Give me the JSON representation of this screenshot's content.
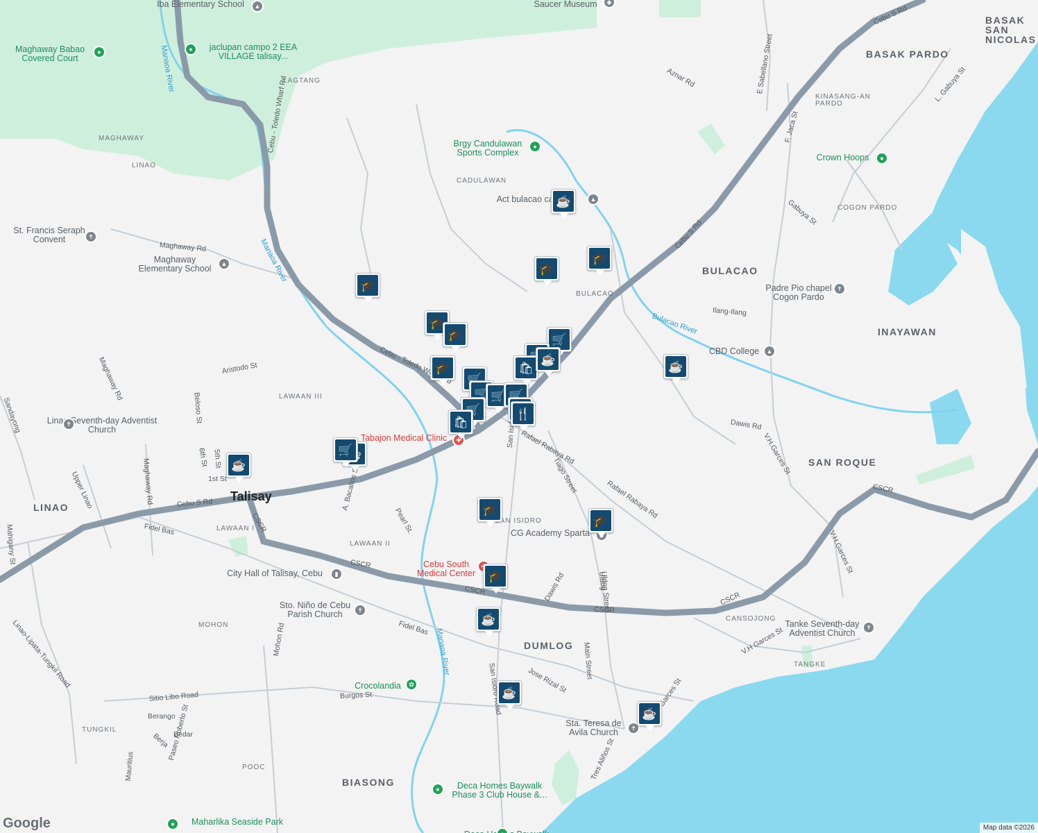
{
  "map": {
    "attribution": "Map data ©2026",
    "logo": "Google",
    "colors": {
      "land": "#f3f3f4",
      "park": "#cfefdd",
      "water": "#8ad9ef",
      "highway": "#8a9aa9",
      "road": "#c5cdd5",
      "river": "#7fd3ee"
    },
    "city_labels": [
      {
        "text": "Talisay"
      }
    ],
    "neighborhoods": [
      {
        "text": "BASAK PARDO"
      },
      {
        "text": "BULACAO"
      },
      {
        "text": "INAYAWAN"
      },
      {
        "text": "SAN ROQUE"
      },
      {
        "text": "LINAO"
      },
      {
        "text": "DUMLOG"
      },
      {
        "text": "BIASONG"
      },
      {
        "text": "BASAK SAN NICOLAS"
      }
    ],
    "small_labels": [
      {
        "text": "LAGTANG"
      },
      {
        "text": "MAGHAWAY"
      },
      {
        "text": "CADULAWAN"
      },
      {
        "text": "LINAO"
      },
      {
        "text": "LAWAAN III"
      },
      {
        "text": "LAWAAN I"
      },
      {
        "text": "LAWAAN II"
      },
      {
        "text": "SAN ISIDRO"
      },
      {
        "text": "MOHON"
      },
      {
        "text": "TUNGKIL"
      },
      {
        "text": "POOC"
      },
      {
        "text": "CANSOJONG"
      },
      {
        "text": "TANGKE"
      },
      {
        "text": "COGON PARDO"
      },
      {
        "text": "KINASANG-AN PARDO"
      },
      {
        "text": "BULACAO"
      }
    ],
    "streets": [
      {
        "text": "Cebu S Rd"
      },
      {
        "text": "Cebu S Rd"
      },
      {
        "text": "Cebu S Rd"
      },
      {
        "text": "CSCR"
      },
      {
        "text": "CSCR"
      },
      {
        "text": "CSCR"
      },
      {
        "text": "CSCR"
      },
      {
        "text": "CSCR"
      },
      {
        "text": "CSCR"
      },
      {
        "text": "Cebu - Toledo Wharf Rd"
      },
      {
        "text": "Cebu - Toledo Wharf Rd"
      },
      {
        "text": "Fidel Bas"
      },
      {
        "text": "Fidel Bas"
      },
      {
        "text": "Rafael Rabaya Rd"
      },
      {
        "text": "Rafael Rabaya Rd"
      },
      {
        "text": "San Isidro Road"
      },
      {
        "text": "San Isidro Road"
      },
      {
        "text": "Tiago Street"
      },
      {
        "text": "Dawis Rd"
      },
      {
        "text": "Dawis Rd"
      },
      {
        "text": "Uldog Street"
      },
      {
        "text": "Uldog"
      },
      {
        "text": "Main Street"
      },
      {
        "text": "Jose Rizal St"
      },
      {
        "text": "V.H.Garces St"
      },
      {
        "text": "V.H.Garces St"
      },
      {
        "text": "V.H Garces St"
      },
      {
        "text": "V.H. Garces St"
      },
      {
        "text": "Gabuya St"
      },
      {
        "text": "L. Gabuya St"
      },
      {
        "text": "F. Jaca St"
      },
      {
        "text": "E Sabellano Street"
      },
      {
        "text": "Aznar Rd"
      },
      {
        "text": "Ilang-Ilang"
      },
      {
        "text": "Maghaway Rd"
      },
      {
        "text": "Maghaway Rd"
      },
      {
        "text": "Maghaway Rd"
      },
      {
        "text": "Aristodo St"
      },
      {
        "text": "Beloso St"
      },
      {
        "text": "6th St"
      },
      {
        "text": "5th St"
      },
      {
        "text": "1st St"
      },
      {
        "text": "A. Bacaltos St"
      },
      {
        "text": "Pearl St."
      },
      {
        "text": "Upper Linao"
      },
      {
        "text": "Sandayong"
      },
      {
        "text": "Mahigany St"
      },
      {
        "text": "Linao-Lipata-Tungkil Road"
      },
      {
        "text": "Mohon Rd"
      },
      {
        "text": "Sitio Libo Road"
      },
      {
        "text": "Burgos St"
      },
      {
        "text": "Berango"
      },
      {
        "text": "Berja"
      },
      {
        "text": "Bedar"
      },
      {
        "text": "Paseo Roberto St"
      },
      {
        "text": "Mauritius"
      },
      {
        "text": "Tres Aliños St"
      }
    ],
    "waters": [
      {
        "text": "Bulacao River"
      },
      {
        "text": "Manaoa River"
      },
      {
        "text": "Manaoa River"
      },
      {
        "text": "Manaoa River"
      }
    ],
    "pois": [
      {
        "text": "Iba Elementary School",
        "icon": "school-icon"
      },
      {
        "text": "Saucer Museum",
        "icon": "museum-icon"
      },
      {
        "text": "jaclupan campo 2 EEA VILLAGE talisay...",
        "icon": "place-icon"
      },
      {
        "text": "Maghaway Babao Covered Court",
        "icon": "place-icon"
      },
      {
        "text": "Brgy Candulawan Sports Complex",
        "icon": "place-icon"
      },
      {
        "text": "Act bulacao campus",
        "icon": "school-icon"
      },
      {
        "text": "Crown Hoops",
        "icon": "place-icon"
      },
      {
        "text": "St. Francis Seraph Convent",
        "icon": "church-icon"
      },
      {
        "text": "Maghaway Elementary School",
        "icon": "school-icon"
      },
      {
        "text": "Padre Pio chapel Cogon Pardo",
        "icon": "church-icon"
      },
      {
        "text": "CBD College",
        "icon": "school-icon"
      },
      {
        "text": "Linao Seventh-day Adventist Church",
        "icon": "church-icon"
      },
      {
        "text": "Tabajon Medical Clinic",
        "icon": "medical-icon"
      },
      {
        "text": "CG Academy Sparta",
        "icon": "school-icon"
      },
      {
        "text": "Cebu South Medical Center",
        "icon": "medical-icon"
      },
      {
        "text": "City Hall of Talisay, Cebu",
        "icon": "city-hall-icon"
      },
      {
        "text": "Sto. Niño de Cebu Parish Church",
        "icon": "church-icon"
      },
      {
        "text": "Tanke Seventh-day Adventist Church",
        "icon": "church-icon"
      },
      {
        "text": "Crocolandia",
        "icon": "zoo-icon"
      },
      {
        "text": "Sta. Teresa de Avila Church",
        "icon": "church-icon"
      },
      {
        "text": "Deca Homes Baywalk Phase 3 Club House &...",
        "icon": "place-icon"
      },
      {
        "text": "Deca Homes Baywalk",
        "icon": "place-icon"
      },
      {
        "text": "Maharlika Seaside Park",
        "icon": "place-icon"
      }
    ],
    "markers": [
      {
        "icon": "cafe-icon",
        "glyph": "☕"
      },
      {
        "icon": "school-icon",
        "glyph": "🎓"
      },
      {
        "icon": "school-icon",
        "glyph": "🎓"
      },
      {
        "icon": "school-icon",
        "glyph": "🎓"
      },
      {
        "icon": "school-icon",
        "glyph": "🎓"
      },
      {
        "icon": "school-icon",
        "glyph": "🎓"
      },
      {
        "icon": "school-icon",
        "glyph": "🎓"
      },
      {
        "icon": "cart-icon",
        "glyph": "🛒"
      },
      {
        "icon": "cart-icon",
        "glyph": "🛒"
      },
      {
        "icon": "cart-icon",
        "glyph": "🛒"
      },
      {
        "icon": "cart-icon",
        "glyph": "🛒"
      },
      {
        "icon": "cart-icon",
        "glyph": "🛒"
      },
      {
        "icon": "cart-icon",
        "glyph": "🛒"
      },
      {
        "icon": "cart-icon",
        "glyph": "🛒"
      },
      {
        "icon": "bag-icon",
        "glyph": "🛍"
      },
      {
        "icon": "bag-icon",
        "glyph": "🛍"
      },
      {
        "icon": "restaurant-icon",
        "glyph": "🍴"
      },
      {
        "icon": "restaurant-icon",
        "glyph": "🍴"
      },
      {
        "icon": "cafe-icon",
        "glyph": "☕"
      },
      {
        "icon": "cart-icon",
        "glyph": "🛒"
      },
      {
        "icon": "cafe-icon",
        "glyph": "☕"
      },
      {
        "icon": "cafe-icon",
        "glyph": "☕"
      },
      {
        "icon": "school-icon",
        "glyph": "🎓"
      },
      {
        "icon": "school-icon",
        "glyph": "🎓"
      },
      {
        "icon": "school-icon",
        "glyph": "🎓"
      },
      {
        "icon": "cafe-icon",
        "glyph": "☕"
      },
      {
        "icon": "cafe-icon",
        "glyph": "☕"
      },
      {
        "icon": "cafe-icon",
        "glyph": "☕"
      },
      {
        "icon": "cafe-icon",
        "glyph": "☕"
      }
    ]
  }
}
